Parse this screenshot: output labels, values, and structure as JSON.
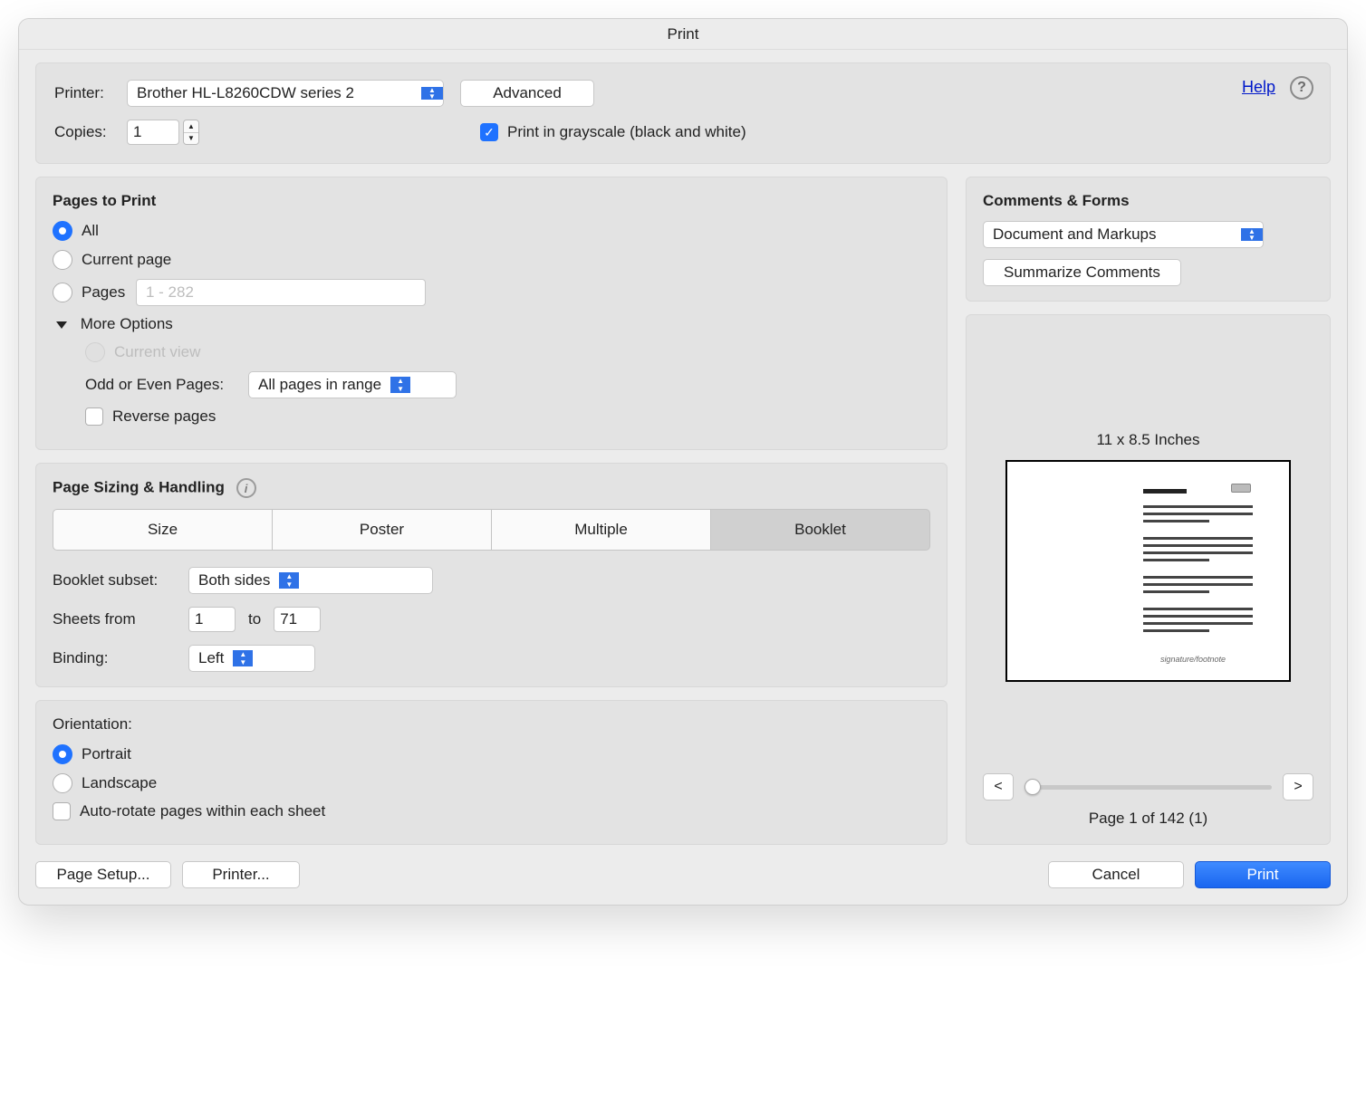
{
  "window": {
    "title": "Print"
  },
  "top": {
    "printer_label": "Printer:",
    "printer_value": "Brother HL-L8260CDW series 2",
    "advanced": "Advanced",
    "help": "Help",
    "copies_label": "Copies:",
    "copies_value": "1",
    "grayscale_label": "Print in grayscale (black and white)"
  },
  "pages": {
    "title": "Pages to Print",
    "all": "All",
    "current_page": "Current page",
    "pages": "Pages",
    "pages_placeholder": "1 - 282",
    "more_options": "More Options",
    "current_view": "Current view",
    "odd_even_label": "Odd or Even Pages:",
    "odd_even_value": "All pages in range",
    "reverse_pages": "Reverse pages"
  },
  "sizing": {
    "title": "Page Sizing & Handling",
    "segments": {
      "size": "Size",
      "poster": "Poster",
      "multiple": "Multiple",
      "booklet": "Booklet"
    },
    "subset_label": "Booklet subset:",
    "subset_value": "Both sides",
    "sheets_from_label": "Sheets from",
    "sheets_from": "1",
    "sheets_to_label": "to",
    "sheets_to": "71",
    "binding_label": "Binding:",
    "binding_value": "Left"
  },
  "orientation": {
    "title": "Orientation:",
    "portrait": "Portrait",
    "landscape": "Landscape",
    "auto_rotate": "Auto-rotate pages within each sheet"
  },
  "comments": {
    "title": "Comments & Forms",
    "dropdown_value": "Document and Markups",
    "summarize": "Summarize Comments"
  },
  "preview": {
    "size_label": "11 x 8.5 Inches",
    "prev": "<",
    "next": ">",
    "page_indicator": "Page 1 of 142 (1)"
  },
  "footer": {
    "page_setup": "Page Setup...",
    "printer": "Printer...",
    "cancel": "Cancel",
    "print": "Print"
  }
}
